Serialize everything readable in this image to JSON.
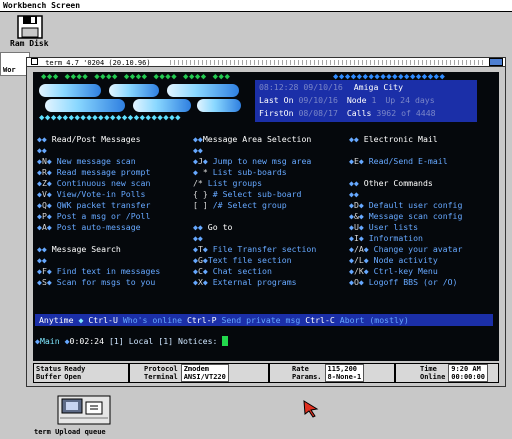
{
  "workbench": {
    "title": "Workbench Screen"
  },
  "desktop_icons": {
    "ram_disk": "Ram Disk",
    "window_fragment": "Wor",
    "upload_queue": "term Upload queue"
  },
  "terminal_window": {
    "title": "term 4.7 '0204 (20.10.96)"
  },
  "bbs": {
    "info": {
      "time": "08:12:28 09/10/16",
      "system": "Amiga City",
      "last_on_label": "Last On",
      "last_on": "09/10/16",
      "node_label": "Node",
      "node": "1",
      "up_label": "Up",
      "up": "24 days",
      "first_on_label": "FirstOn",
      "first_on": "08/08/17",
      "calls_label": "Calls",
      "calls": "3962 of 4448"
    },
    "sections": {
      "read_post": "Read/Post Messages",
      "msg_area": "Message Area Selection",
      "email": "Electronic Mail",
      "other": "Other Commands",
      "goto": "Go to",
      "msg_search": "Message Search"
    },
    "left_items": [
      {
        "key": "N",
        "text": "New message scan"
      },
      {
        "key": "R",
        "text": "Read message prompt"
      },
      {
        "key": "Z",
        "text": "Continuous new scan"
      },
      {
        "key": "V",
        "text": "View/Vote-in Polls"
      },
      {
        "key": "Q",
        "text": "QWK packet transfer"
      },
      {
        "key": "P",
        "text": "Post a msg or /Poll"
      },
      {
        "key": "A",
        "text": "Post auto-message"
      }
    ],
    "search_items": [
      {
        "key": "F",
        "text": "Find text in messages"
      },
      {
        "key": "S",
        "text": "Scan for msgs to you"
      }
    ],
    "mid_items": [
      {
        "key": "J",
        "text": "Jump to new msg area"
      },
      {
        "key": "*",
        "text": "List sub-boards"
      },
      {
        "key": "/*",
        "text": "List groups"
      },
      {
        "key": "{ }",
        "text": "# Select sub-board"
      },
      {
        "key": "[ ]",
        "text": "/# Select group"
      }
    ],
    "goto_items": [
      {
        "key": "T",
        "text": "File Transfer section"
      },
      {
        "key": "G",
        "text": "Text file section"
      },
      {
        "key": "C",
        "text": "Chat section"
      },
      {
        "key": "X",
        "text": "External programs"
      }
    ],
    "email_items": [
      {
        "key": "E",
        "text": "Read/Send E-mail"
      }
    ],
    "other_items": [
      {
        "key": "D",
        "text": "Default user config"
      },
      {
        "key": "&",
        "text": "Message scan config"
      },
      {
        "key": "U",
        "text": "User lists"
      },
      {
        "key": "I",
        "text": "Information"
      },
      {
        "key": "/A",
        "text": "Change your avatar"
      },
      {
        "key": "/L",
        "text": "Node activity"
      },
      {
        "key": "/K",
        "text": "Ctrl-key Menu"
      },
      {
        "key": "O",
        "text": "Logoff BBS (or /O)"
      }
    ],
    "help_bar": {
      "anytime": "Anytime",
      "k1": "Ctrl-U",
      "t1": "Who's online",
      "k2": "Ctrl-P",
      "t2": "Send private msg",
      "k3": "Ctrl-C",
      "t3": "Abort (mostly)"
    },
    "prompt": {
      "area": "Main",
      "time": "0:02:24",
      "sub": "[1] Local",
      "notices": "[1] Notices:"
    }
  },
  "status_bar": [
    {
      "label": "Status",
      "value": "Ready",
      "sub_label": "Buffer",
      "sub_value": "Open"
    },
    {
      "label": "Protocol",
      "value": "Zmodem",
      "sub_label": "Terminal",
      "sub_value": "ANSI/VT220"
    },
    {
      "label": "Rate",
      "value": "115,200",
      "sub_label": "Params.",
      "sub_value": "8-None-1"
    },
    {
      "label": "Time",
      "value": "9:20 AM",
      "sub_label": "Online",
      "sub_value": "00:00:00"
    }
  ],
  "colors": {
    "terminal_bg": "#05080c",
    "info_bg": "#1b2fa8",
    "accent_blue": "#66a8ff",
    "accent_green": "#4fe070",
    "desktop": "#c8c8c8"
  }
}
